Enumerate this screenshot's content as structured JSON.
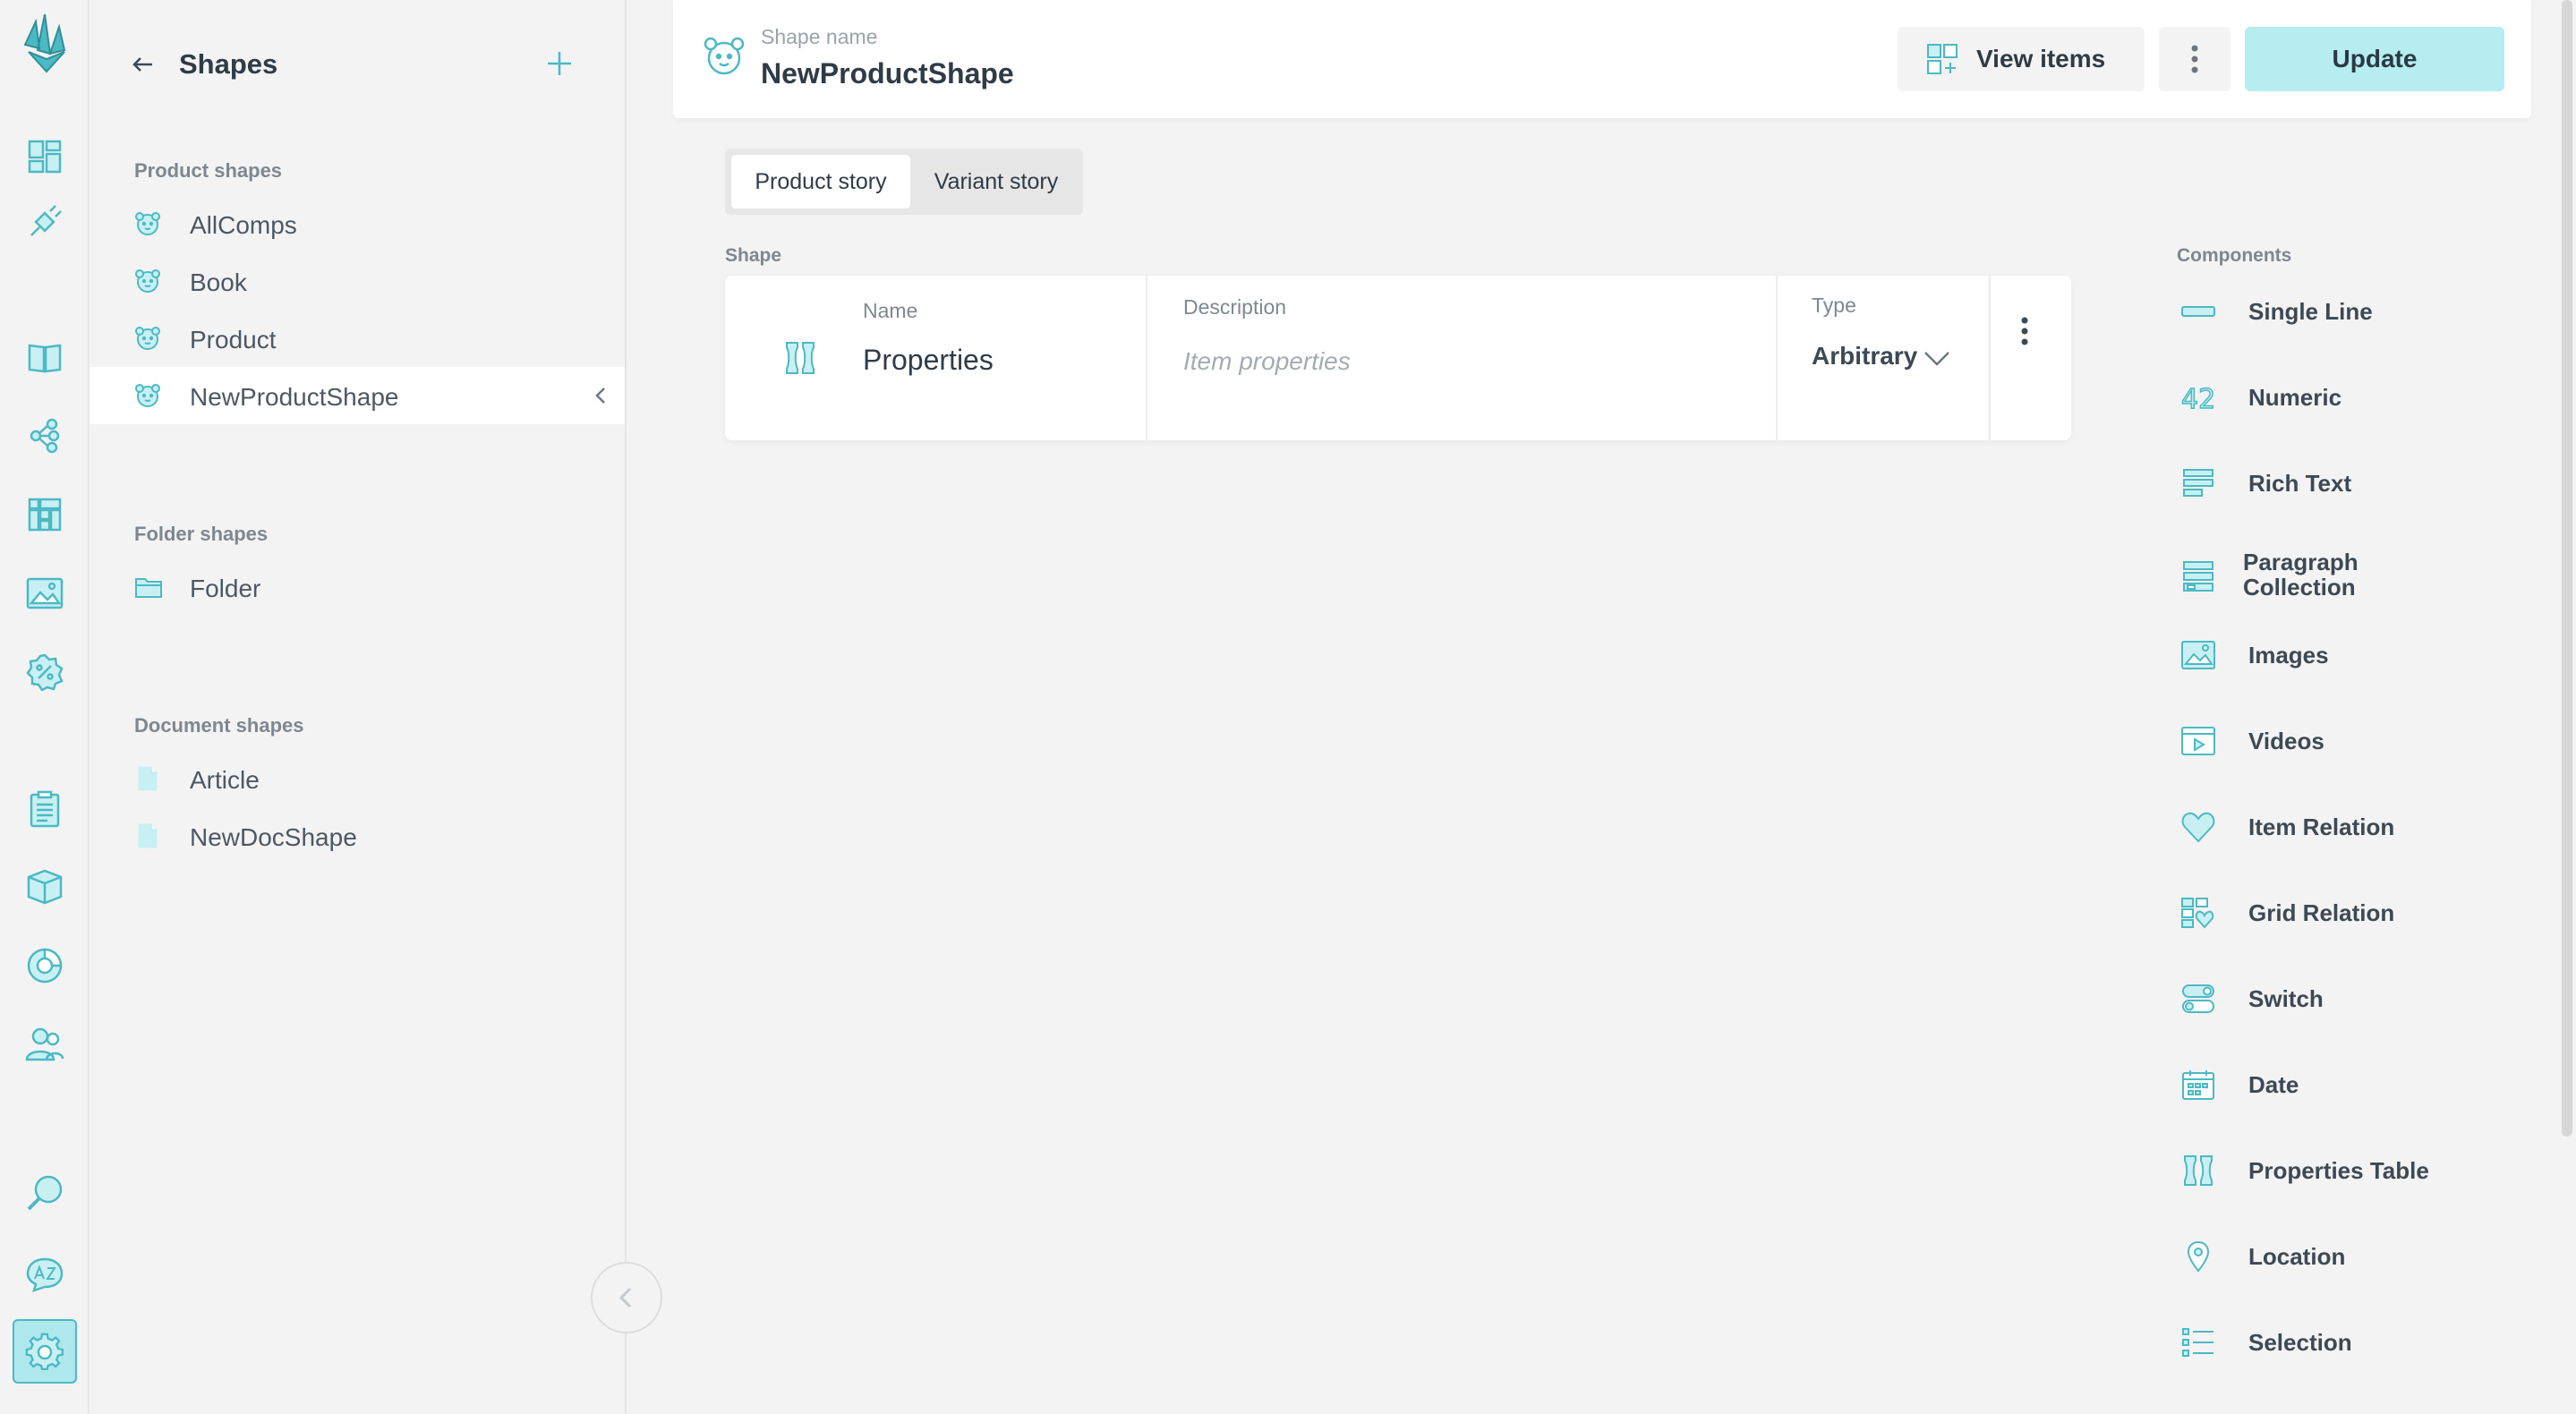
{
  "colors": {
    "accent": "#4cb9c4",
    "accent_light": "#b5edf1",
    "icon_fill": "#c8f0f3",
    "text_dark": "#2f3b47",
    "text_muted": "#7e8790"
  },
  "rail": {
    "items": [
      {
        "name": "logo-icon"
      },
      {
        "name": "dashboard-icon"
      },
      {
        "name": "plugin-icon"
      },
      {
        "name": "catalogue-icon"
      },
      {
        "name": "topics-icon"
      },
      {
        "name": "grids-icon"
      },
      {
        "name": "media-icon"
      },
      {
        "name": "discounts-icon"
      },
      {
        "name": "orders-icon"
      },
      {
        "name": "products-icon"
      },
      {
        "name": "analytics-icon"
      },
      {
        "name": "customers-icon"
      },
      {
        "name": "search-icon"
      },
      {
        "name": "translate-icon"
      },
      {
        "name": "settings-icon"
      }
    ]
  },
  "sidebar": {
    "title": "Shapes",
    "groups": [
      {
        "title": "Product shapes",
        "items": [
          "AllComps",
          "Book",
          "Product",
          "NewProductShape"
        ],
        "selected": "NewProductShape"
      },
      {
        "title": "Folder shapes",
        "items": [
          "Folder"
        ]
      },
      {
        "title": "Document shapes",
        "items": [
          "Article",
          "NewDocShape"
        ]
      }
    ]
  },
  "topbar": {
    "label": "Shape name",
    "name": "NewProductShape",
    "view_items": "View items",
    "update": "Update"
  },
  "tabs": [
    "Product story",
    "Variant story"
  ],
  "shape": {
    "section_label": "Shape",
    "name_caption": "Name",
    "name": "Properties",
    "description_caption": "Description",
    "description_placeholder": "Item properties",
    "type_caption": "Type",
    "type_value": "Arbitrary"
  },
  "components": {
    "title": "Components",
    "items": [
      {
        "label": "Single Line",
        "icon": "single-line-icon"
      },
      {
        "label": "Numeric",
        "icon": "numeric-icon"
      },
      {
        "label": "Rich Text",
        "icon": "rich-text-icon"
      },
      {
        "label": "Paragraph Collection",
        "icon": "paragraph-collection-icon"
      },
      {
        "label": "Images",
        "icon": "images-icon"
      },
      {
        "label": "Videos",
        "icon": "videos-icon"
      },
      {
        "label": "Item Relation",
        "icon": "item-relation-icon"
      },
      {
        "label": "Grid Relation",
        "icon": "grid-relation-icon"
      },
      {
        "label": "Switch",
        "icon": "switch-icon"
      },
      {
        "label": "Date",
        "icon": "date-icon"
      },
      {
        "label": "Properties Table",
        "icon": "properties-table-icon"
      },
      {
        "label": "Location",
        "icon": "location-icon"
      },
      {
        "label": "Selection",
        "icon": "selection-icon"
      }
    ]
  }
}
